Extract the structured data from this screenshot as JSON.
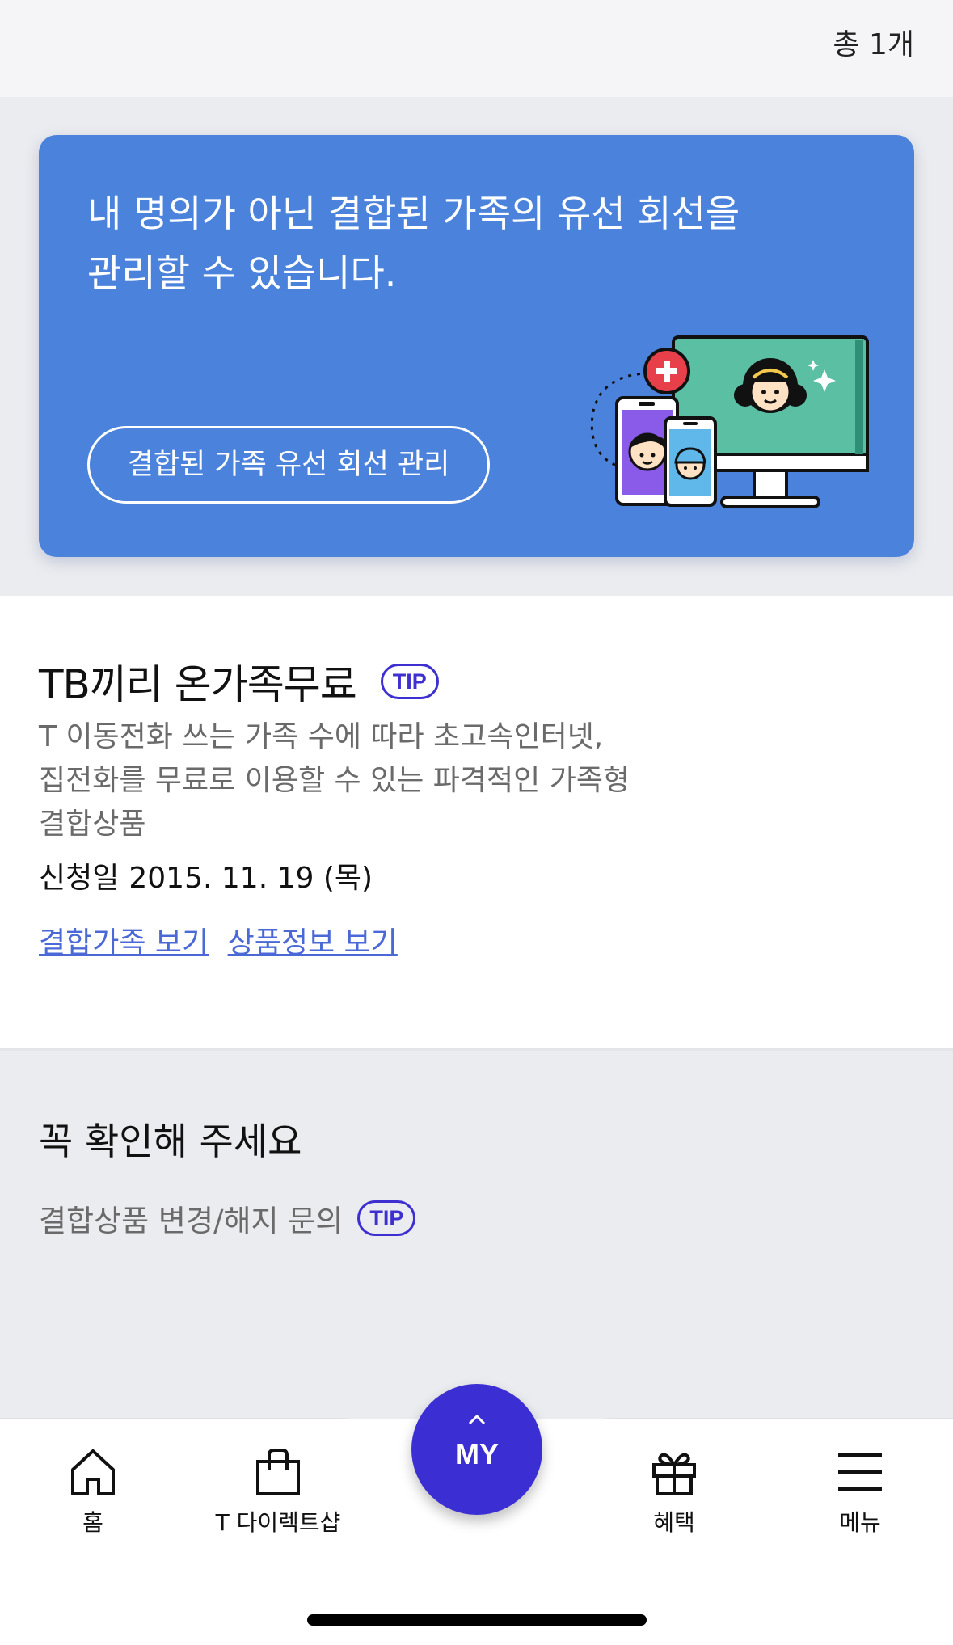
{
  "header": {
    "total_count": "총 1개"
  },
  "banner": {
    "text": "내 명의가 아닌 결합된 가족의 유선 회선을\n관리할 수 있습니다.",
    "button_label": "결합된 가족 유선 회선 관리",
    "colors": {
      "background": "#4a82dc",
      "accent_plus": "#e8404a",
      "monitor": "#5bbfa4",
      "phone_left": "#8a5ae8",
      "phone_right": "#5fb7ea"
    }
  },
  "product": {
    "title": "TB끼리 온가족무료",
    "tip_label": "TIP",
    "description": "T 이동전화 쓰는 가족 수에 따라 초고속인터넷,\n집전화를 무료로 이용할 수 있는 파격적인 가족형\n결합상품",
    "apply_label": "신청일",
    "apply_date": "2015. 11. 19 (목)",
    "links": [
      "결합가족 보기",
      "상품정보 보기"
    ]
  },
  "notice": {
    "title": "꼭 확인해 주세요",
    "item_label": "결합상품 변경/해지 문의",
    "tip_label": "TIP"
  },
  "tabbar": {
    "items": [
      {
        "label": "홈",
        "icon": "home-icon"
      },
      {
        "label": "T 다이렉트샵",
        "icon": "shopping-bag-icon"
      },
      {
        "label": "혜택",
        "icon": "gift-icon"
      },
      {
        "label": "메뉴",
        "icon": "hamburger-menu-icon"
      }
    ],
    "center_label": "MY",
    "center_color": "#3b2fd3"
  }
}
